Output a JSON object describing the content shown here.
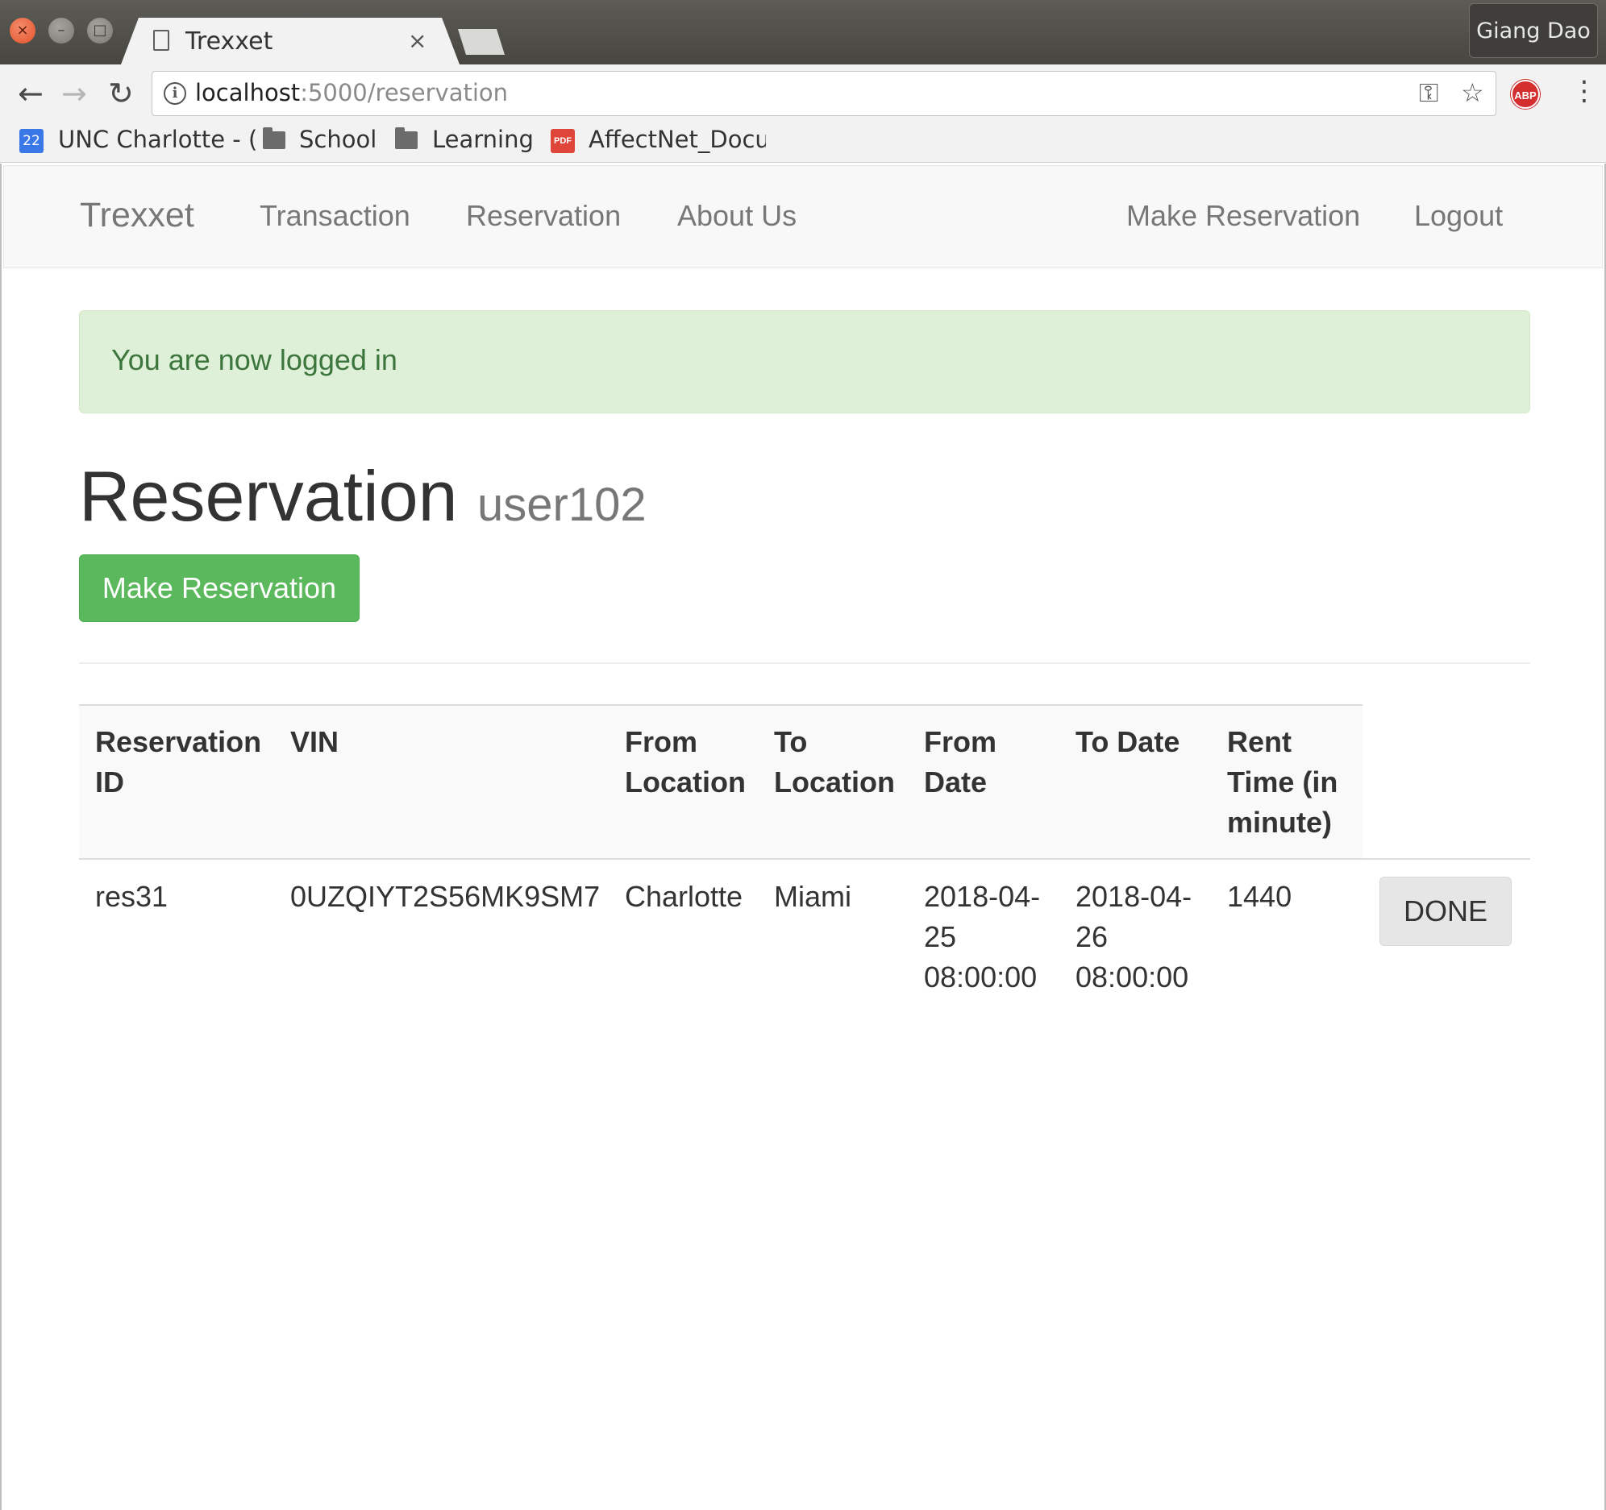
{
  "browser": {
    "window_controls": {
      "close": "×",
      "minimize": "–",
      "maximize": "□"
    },
    "tab": {
      "title": "Trexxet",
      "close": "×"
    },
    "profile": "Giang Dao",
    "url": {
      "host": "localhost",
      "path": ":5000/reservation"
    },
    "bookmarks": [
      {
        "label": "UNC Charlotte - (",
        "icon": "calendar-icon",
        "badge": "22"
      },
      {
        "label": "School",
        "icon": "folder-icon"
      },
      {
        "label": "Learning",
        "icon": "folder-icon"
      },
      {
        "label": "AffectNet_Docu",
        "icon": "pdf-icon",
        "badge": "PDF"
      }
    ],
    "extension_badge": "ABP"
  },
  "navbar": {
    "brand": "Trexxet",
    "left_links": [
      "Transaction",
      "Reservation",
      "About Us"
    ],
    "right_links": [
      "Make Reservation",
      "Logout"
    ]
  },
  "alert": {
    "message": "You are now logged in"
  },
  "page": {
    "title": "Reservation",
    "subtitle": "user102",
    "make_button": "Make Reservation"
  },
  "table": {
    "headers": [
      [
        "Reservation",
        "ID"
      ],
      [
        "VIN"
      ],
      [
        "From",
        "Location"
      ],
      [
        "To",
        "Location"
      ],
      [
        "From",
        "Date"
      ],
      [
        "To Date"
      ],
      [
        "Rent",
        "Time (in",
        "minute)"
      ]
    ],
    "rows": [
      {
        "reservation_id": "res31",
        "vin": "0UZQIYT2S56MK9SM7",
        "from_location": "Charlotte",
        "to_location": "Miami",
        "from_date": [
          "2018-04-",
          "25",
          "08:00:00"
        ],
        "to_date": [
          "2018-04-",
          "26",
          "08:00:00"
        ],
        "rent_time": "1440",
        "action": "DONE"
      }
    ]
  },
  "colors": {
    "success": "#5cb85c",
    "alert_bg": "#dff0d8",
    "alert_text": "#3c763d",
    "navbar_bg": "#f8f8f8"
  }
}
